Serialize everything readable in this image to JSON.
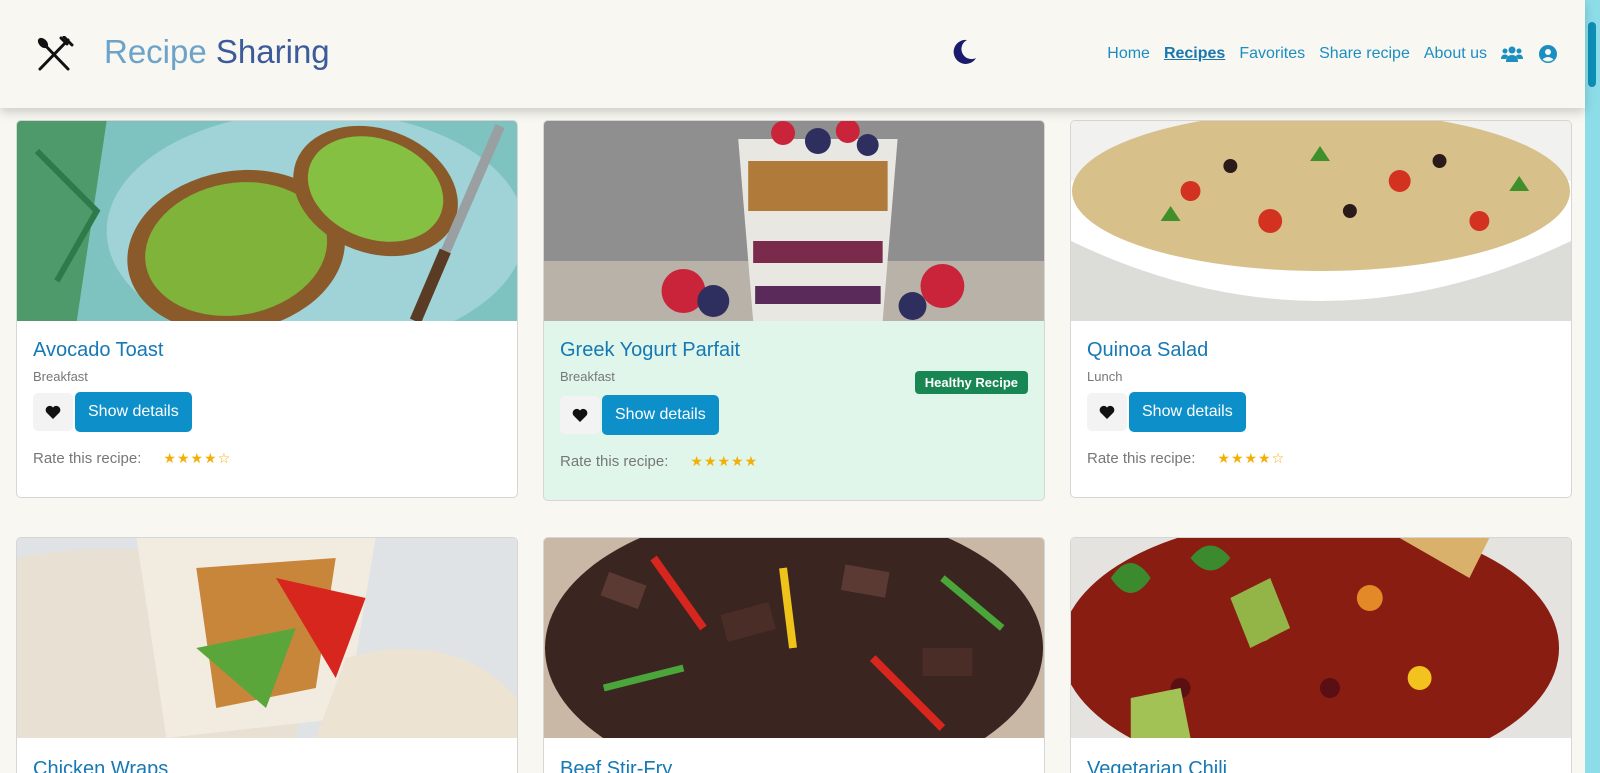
{
  "header": {
    "brand_part1": "Recipe",
    "brand_part2": "Sharing",
    "theme_icon": "moon-icon",
    "logo_icon": "fork-knife-icon"
  },
  "nav": {
    "home": "Home",
    "recipes": "Recipes",
    "favorites": "Favorites",
    "share": "Share recipe",
    "about": "About us",
    "community_icon": "users-icon",
    "account_icon": "user-circle-icon"
  },
  "recipes": [
    {
      "title": "Avocado Toast",
      "category": "Breakfast",
      "rating": 4,
      "rate_label": "Rate this recipe:",
      "stars": "★★★★☆",
      "button": "Show details",
      "healthy": false,
      "image": "avocado-toast-photo"
    },
    {
      "title": "Greek Yogurt Parfait",
      "category": "Breakfast",
      "rating": 5,
      "rate_label": "Rate this recipe:",
      "stars": "★★★★★",
      "button": "Show details",
      "healthy": true,
      "badge": "Healthy Recipe",
      "image": "yogurt-parfait-photo"
    },
    {
      "title": "Quinoa Salad",
      "category": "Lunch",
      "rating": 4,
      "rate_label": "Rate this recipe:",
      "stars": "★★★★☆",
      "button": "Show details",
      "healthy": false,
      "image": "quinoa-salad-photo"
    },
    {
      "title": "Chicken Wraps",
      "image": "chicken-wraps-photo"
    },
    {
      "title": "Beef Stir-Fry",
      "image": "beef-stir-fry-photo"
    },
    {
      "title": "Vegetarian Chili",
      "image": "vegetarian-chili-photo"
    }
  ],
  "colors": {
    "accent": "#0d8fc9",
    "healthy_badge": "#198754",
    "healthy_card": "#e0f6ea",
    "stars": "#f2b007"
  }
}
